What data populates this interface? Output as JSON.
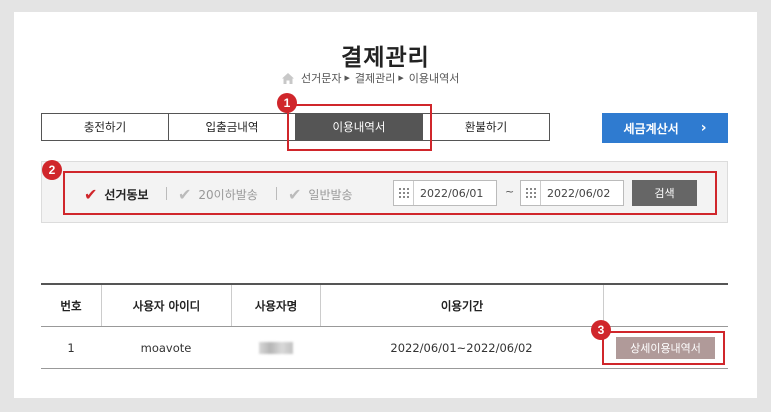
{
  "page": {
    "title": "결제관리"
  },
  "breadcrumb": {
    "items": [
      "선거문자",
      "결제관리",
      "이용내역서"
    ]
  },
  "tabs": [
    {
      "label": "충전하기",
      "active": false
    },
    {
      "label": "입출금내역",
      "active": false
    },
    {
      "label": "이용내역서",
      "active": true
    },
    {
      "label": "환불하기",
      "active": false
    }
  ],
  "tax_button": {
    "label": "세금계산서",
    "arrow": "›"
  },
  "filters": {
    "options": [
      {
        "label": "선거동보",
        "checked": true
      },
      {
        "label": "20이하발송",
        "checked": false
      },
      {
        "label": "일반발송",
        "checked": false
      }
    ],
    "separator": "|",
    "start_date": "2022/06/01",
    "tilde": "~",
    "end_date": "2022/06/02",
    "search_label": "검색"
  },
  "table": {
    "headers": [
      "번호",
      "사용자 아이디",
      "사용자명",
      "이용기간",
      ""
    ],
    "rows": [
      {
        "no": "1",
        "user_id": "moavote",
        "period": "2022/06/01~2022/06/02",
        "action": "상세이용내역서"
      }
    ]
  },
  "annotations": {
    "markers": [
      "1",
      "2",
      "3"
    ],
    "color": "#d0262b"
  },
  "colors": {
    "accent_blue": "#2f7bd0",
    "active_tab": "#555555",
    "detail_button": "#b09a99"
  }
}
